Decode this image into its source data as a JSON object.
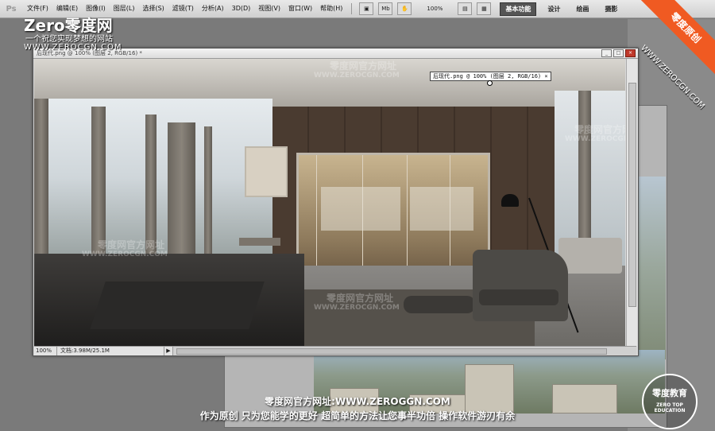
{
  "app": {
    "logo_text": "Ps",
    "menus": [
      "文件(F)",
      "编辑(E)",
      "图像(I)",
      "图层(L)",
      "选择(S)",
      "滤镜(T)",
      "分析(A)",
      "3D(D)",
      "视图(V)",
      "窗口(W)",
      "帮助(H)"
    ],
    "toolbar": {
      "zoom_value": "100%",
      "mb_label": "Mb"
    },
    "workspaces": [
      "基本功能",
      "设计",
      "绘画",
      "摄影"
    ]
  },
  "document": {
    "title": "后现代.png @ 100% (图层 2, RGB/16) *",
    "layer_tooltip": "后现代.png @ 100% (图层 2, RGB/16) ×",
    "status_zoom": "100%",
    "status_info": "文档:3.98M/25.1M",
    "arrow": "▶"
  },
  "watermark": {
    "brand": "Zero零度网",
    "slogan": "一个祝您实现梦想的网站",
    "url": "WWW.ZEROCGN.COM",
    "corner_text": "零度原创",
    "corner_url": "WWW.ZEROCGN.COM",
    "faint_cn": "零度网官方网址",
    "faint_url": "WWW.ZEROCGN.COM",
    "bottom_line1": "零度网官方网址:WWW.ZEROGGN.COM",
    "bottom_line2": "作为原创 只为您能学的更好 超简单的方法让您事半功倍 操作软件游刃有余",
    "badge_title": "零度教育",
    "badge_sub": "ZERO TOP EDUCATION"
  },
  "colors": {
    "menubar": "#dcdcdc",
    "workspace_bg": "#7a7a7a",
    "accent_orange": "#f05a22"
  }
}
